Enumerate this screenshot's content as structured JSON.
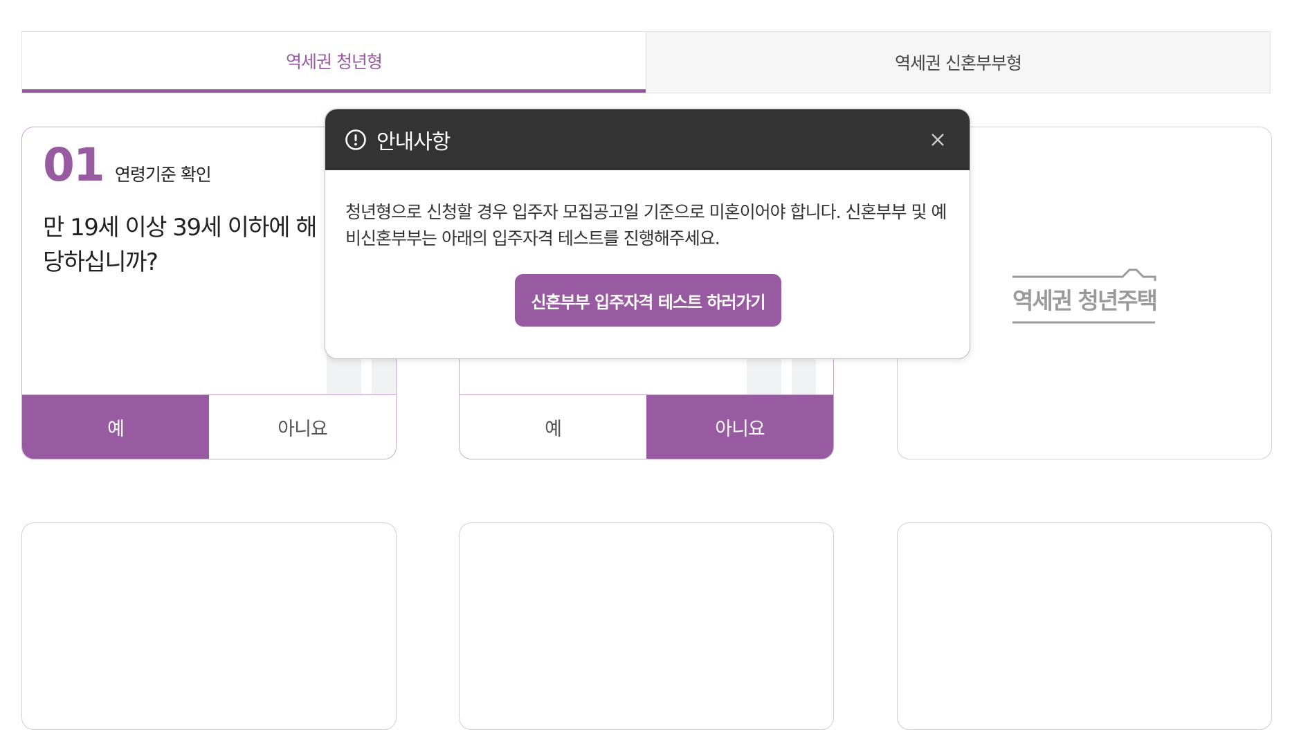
{
  "tabs": [
    {
      "label": "역세권 청년형",
      "active": true
    },
    {
      "label": "역세권 신혼부부형",
      "active": false
    }
  ],
  "cards": [
    {
      "step_number": "01",
      "step_label": "연령기준 확인",
      "question": "만 19세 이상 39세 이하에 해당하십니까?",
      "yes_label": "예",
      "no_label": "아니요",
      "selected": "yes"
    },
    {
      "yes_label": "예",
      "no_label": "아니요",
      "selected": "no"
    }
  ],
  "logo": {
    "text": "역세권 청년주택"
  },
  "modal": {
    "icon": "exclamation-circle-icon",
    "title": "안내사항",
    "body": "청년형으로 신청할 경우 입주자 모집공고일 기준으로 미혼이어야 합니다. 신혼부부 및 예비신혼부부는 아래의 입주자격 테스트를 진행해주세요.",
    "button_label": "신혼부부 입주자격 테스트 하러가기",
    "close_icon": "close-icon"
  },
  "colors": {
    "accent": "#985aa1",
    "modal_header": "#333333",
    "tab_inactive_bg": "#f6f6f6",
    "logo_gray": "#9a9a9a"
  }
}
